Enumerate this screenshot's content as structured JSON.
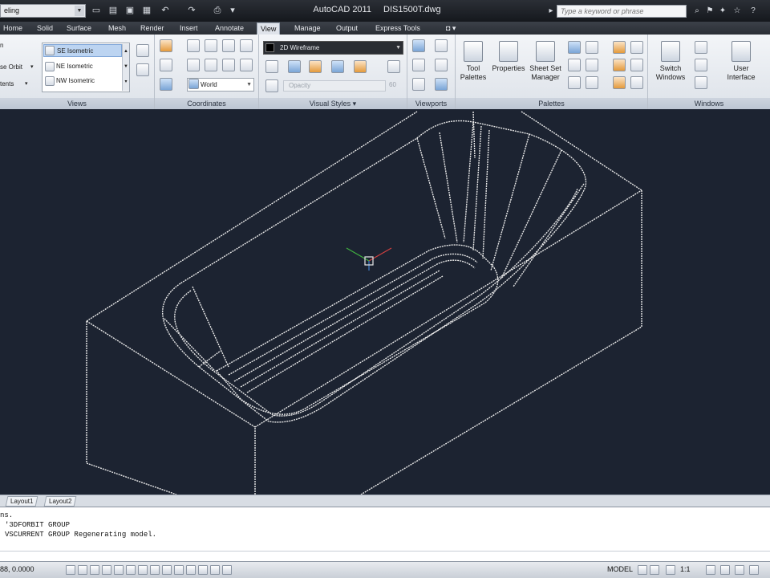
{
  "titlebar": {
    "workspace": "eling",
    "app_name": "AutoCAD 2011",
    "file_name": "DIS1500T.dwg",
    "search_placeholder": "Type a keyword or phrase"
  },
  "tabs": [
    {
      "label": "Home"
    },
    {
      "label": "Solid"
    },
    {
      "label": "Surface"
    },
    {
      "label": "Mesh"
    },
    {
      "label": "Render"
    },
    {
      "label": "Insert"
    },
    {
      "label": "Annotate"
    },
    {
      "label": "View"
    },
    {
      "label": "Manage"
    },
    {
      "label": "Output"
    },
    {
      "label": "Express Tools"
    }
  ],
  "active_tab": "View",
  "ribbon": {
    "views": {
      "title": "Views",
      "left_items": [
        "n",
        "se Orbit",
        "tents"
      ],
      "list": [
        "SE Isometric",
        "NE Isometric",
        "NW Isometric"
      ]
    },
    "coordinates": {
      "title": "Coordinates",
      "ucs_combo": "World"
    },
    "visual_styles": {
      "title": "Visual Styles",
      "style_combo": "2D Wireframe",
      "opacity_label": "Opacity",
      "opacity_value": "60"
    },
    "viewports": {
      "title": "Viewports"
    },
    "palettes": {
      "title": "Palettes",
      "buttons": [
        "Tool Palettes",
        "Properties",
        "Sheet Set Manager"
      ]
    },
    "windows": {
      "title": "Windows",
      "buttons": [
        "Switch Windows",
        "User Interface"
      ]
    }
  },
  "layout_tabs": [
    "Layout1",
    "Layout2"
  ],
  "command_history": [
    "ns.",
    "'3DFORBIT GROUP",
    "VSCURRENT GROUP Regenerating model."
  ],
  "status": {
    "coords": "88, 0.0000",
    "model": "MODEL",
    "scale": "1:1"
  },
  "colors": {
    "canvas_bg": "#1c2331",
    "wireframe": "#e8e8e8",
    "ucs_red": "#d04040",
    "ucs_green": "#40b040"
  }
}
